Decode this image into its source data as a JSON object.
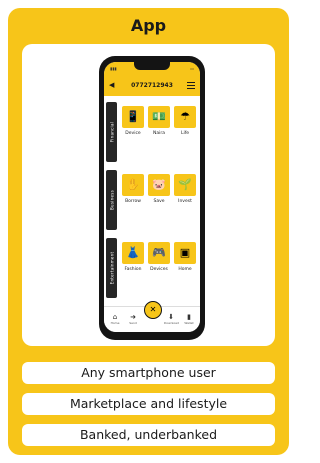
{
  "card": {
    "title": "App",
    "accent_color": "#f7c519"
  },
  "phone": {
    "app_header_number": "0772712943",
    "side_tabs": [
      {
        "label": "Financial"
      },
      {
        "label": "Business"
      },
      {
        "label": "Entertainment"
      }
    ],
    "tiles": [
      {
        "label": "Device",
        "icon": "phone-icon"
      },
      {
        "label": "Naira",
        "icon": "money-icon"
      },
      {
        "label": "Life",
        "icon": "umbrella-icon"
      },
      {
        "label": "Borrow",
        "icon": "hand-icon"
      },
      {
        "label": "Save",
        "icon": "piggy-bank-icon"
      },
      {
        "label": "Invest",
        "icon": "plant-icon"
      },
      {
        "label": "Fashion",
        "icon": "dress-icon"
      },
      {
        "label": "Devices",
        "icon": "gamepad-icon"
      },
      {
        "label": "Home",
        "icon": "appliance-icon"
      }
    ],
    "bottom_nav": [
      {
        "label": "Home",
        "icon": "home-icon"
      },
      {
        "label": "Send",
        "icon": "send-icon"
      },
      {
        "label": "",
        "icon": "center-action-icon"
      },
      {
        "label": "Download",
        "icon": "download-icon"
      },
      {
        "label": "Wallet",
        "icon": "wallet-icon"
      }
    ]
  },
  "features": [
    "Any smartphone user",
    "Marketplace and lifestyle",
    "Banked, underbanked"
  ]
}
